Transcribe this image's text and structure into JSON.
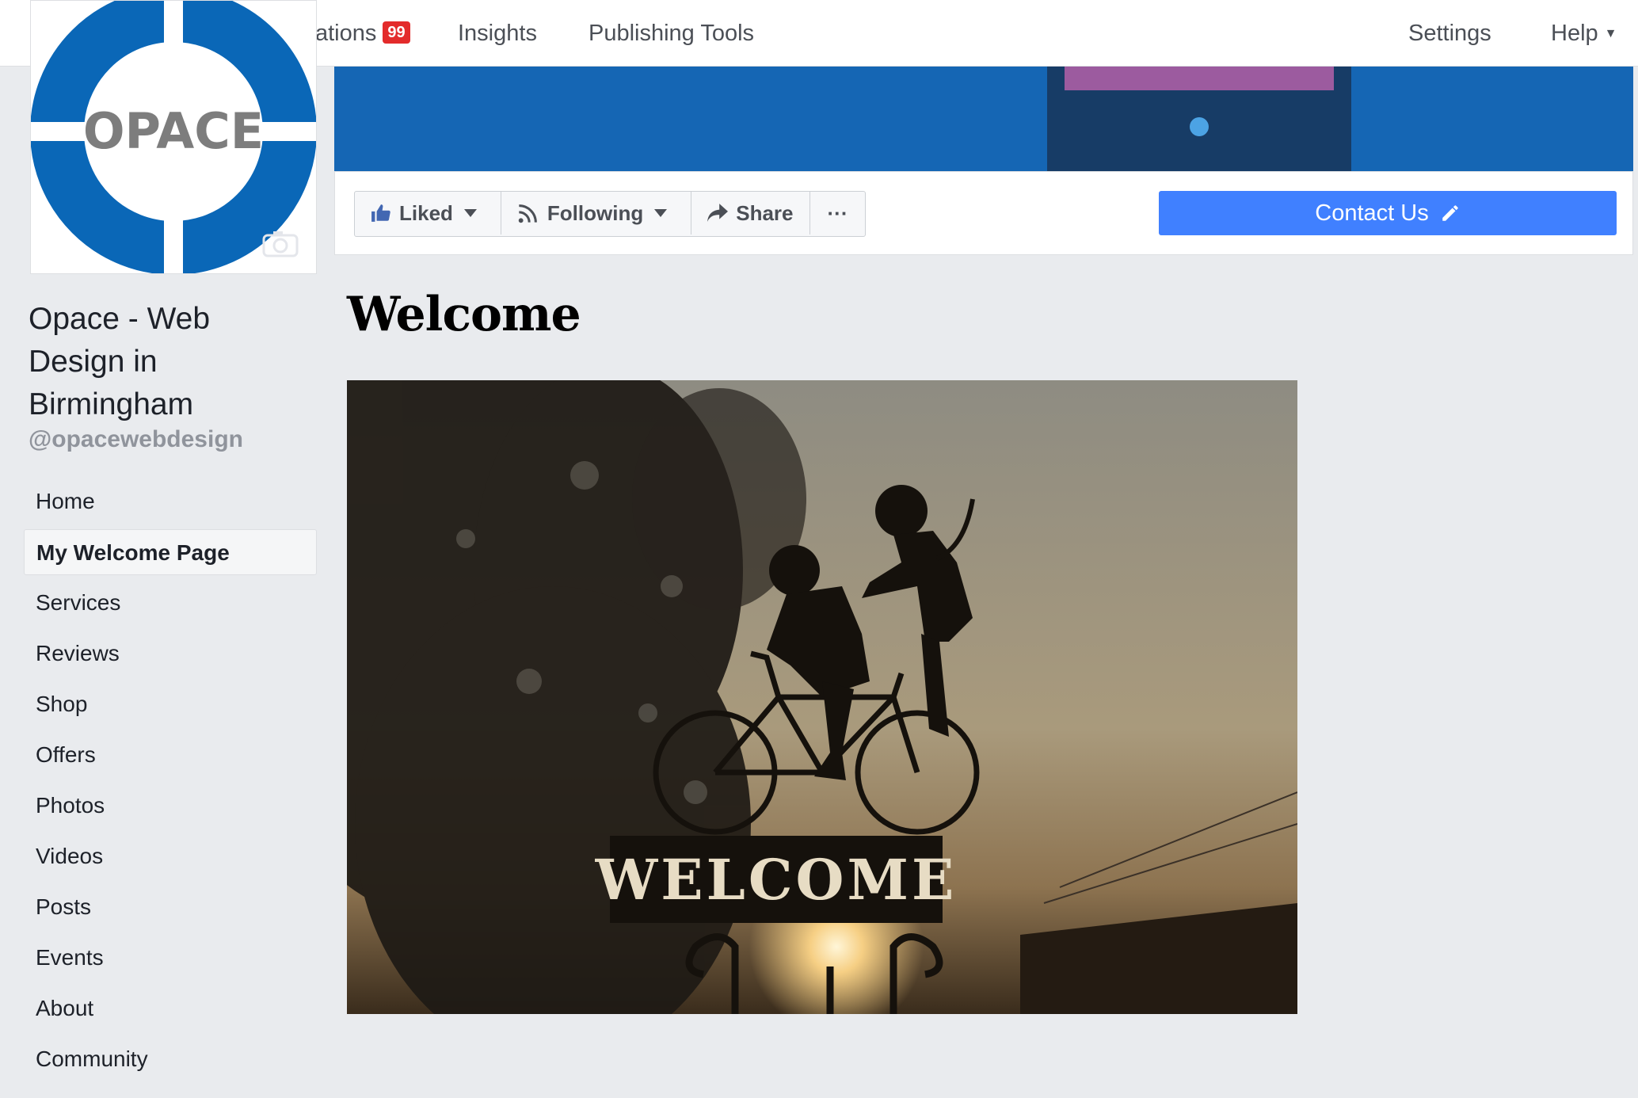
{
  "topnav": {
    "notifications_label": "ations",
    "notifications_count": "99",
    "insights": "Insights",
    "publishing_tools": "Publishing Tools",
    "settings": "Settings",
    "help": "Help"
  },
  "profile": {
    "logo_text": "OPACE",
    "name": "Opace - Web Design in Birmingham",
    "handle": "@opacewebdesign"
  },
  "actions": {
    "liked": "Liked",
    "following": "Following",
    "share": "Share",
    "more": "···",
    "contact": "Contact Us"
  },
  "sidebar": {
    "items": [
      {
        "label": "Home"
      },
      {
        "label": "My Welcome Page"
      },
      {
        "label": "Services"
      },
      {
        "label": "Reviews"
      },
      {
        "label": "Shop"
      },
      {
        "label": "Offers"
      },
      {
        "label": "Photos"
      },
      {
        "label": "Videos"
      },
      {
        "label": "Posts"
      },
      {
        "label": "Events"
      },
      {
        "label": "About"
      },
      {
        "label": "Community"
      }
    ],
    "active_index": 1
  },
  "main": {
    "title": "Welcome",
    "image_sign_text": "WELCOME"
  },
  "colors": {
    "brand_blue": "#1566b4",
    "primary_button": "#4080ff",
    "badge_red": "#e32b2b",
    "logo_blue": "#0a67b7"
  }
}
